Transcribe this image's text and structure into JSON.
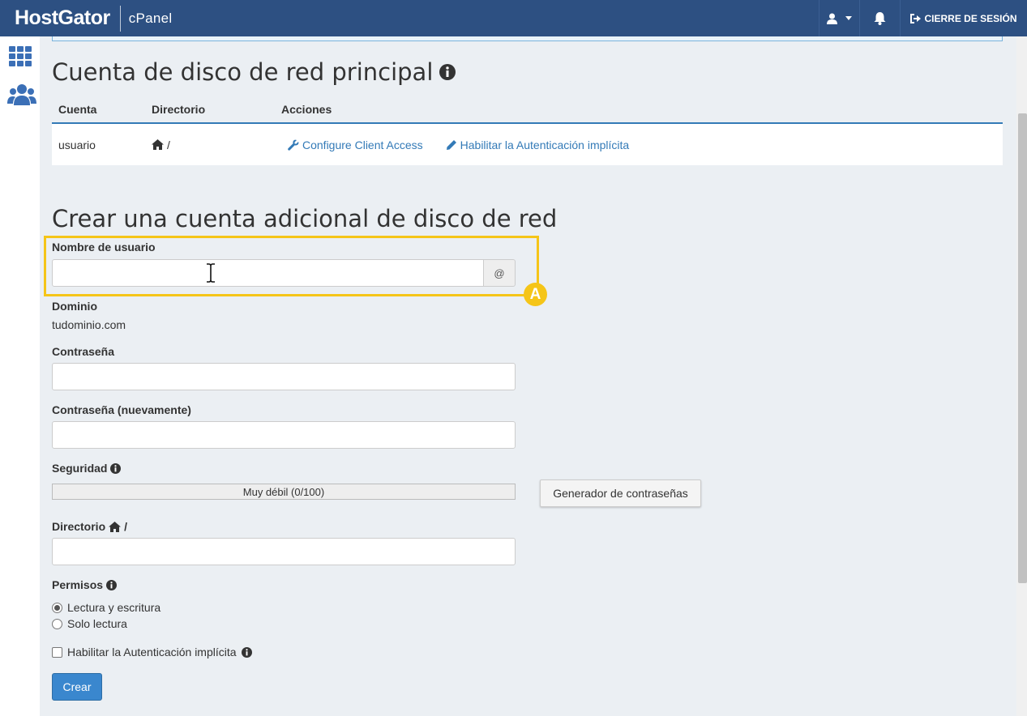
{
  "header": {
    "logo": "HostGator",
    "product": "cPanel",
    "logout_label": "CIERRE DE SESIÓN"
  },
  "primary": {
    "title": "Cuenta de disco de red principal",
    "columns": [
      "Cuenta",
      "Directorio",
      "Acciones"
    ],
    "row": {
      "account": "usuario",
      "directory": "/",
      "action_configure": "Configure Client Access",
      "action_auth": "Habilitar la Autenticación implícita"
    }
  },
  "create": {
    "title": "Crear una cuenta adicional de disco de red",
    "username_label": "Nombre de usuario",
    "username_value": "",
    "at_symbol": "@",
    "badge": "A",
    "domain_label": "Dominio",
    "domain_value": "tudominio.com",
    "password_label": "Contraseña",
    "password_again_label": "Contraseña (nuevamente)",
    "security_label": "Seguridad",
    "strength_text": "Muy débil (0/100)",
    "strength_value": 0,
    "generator_label": "Generador de contraseñas",
    "directory_label": "Directorio",
    "directory_suffix": "/",
    "permissions_label": "Permisos",
    "perm_rw": "Lectura y escritura",
    "perm_ro": "Solo lectura",
    "perm_selected": "Lectura y escritura",
    "implicit_auth_label": "Habilitar la Autenticación implícita",
    "implicit_auth_checked": false,
    "submit_label": "Crear"
  },
  "colors": {
    "topbar": "#2d5082",
    "link": "#337ab7",
    "highlight": "#f5c518",
    "primary_button": "#3a87ce",
    "background": "#ebeff3"
  }
}
